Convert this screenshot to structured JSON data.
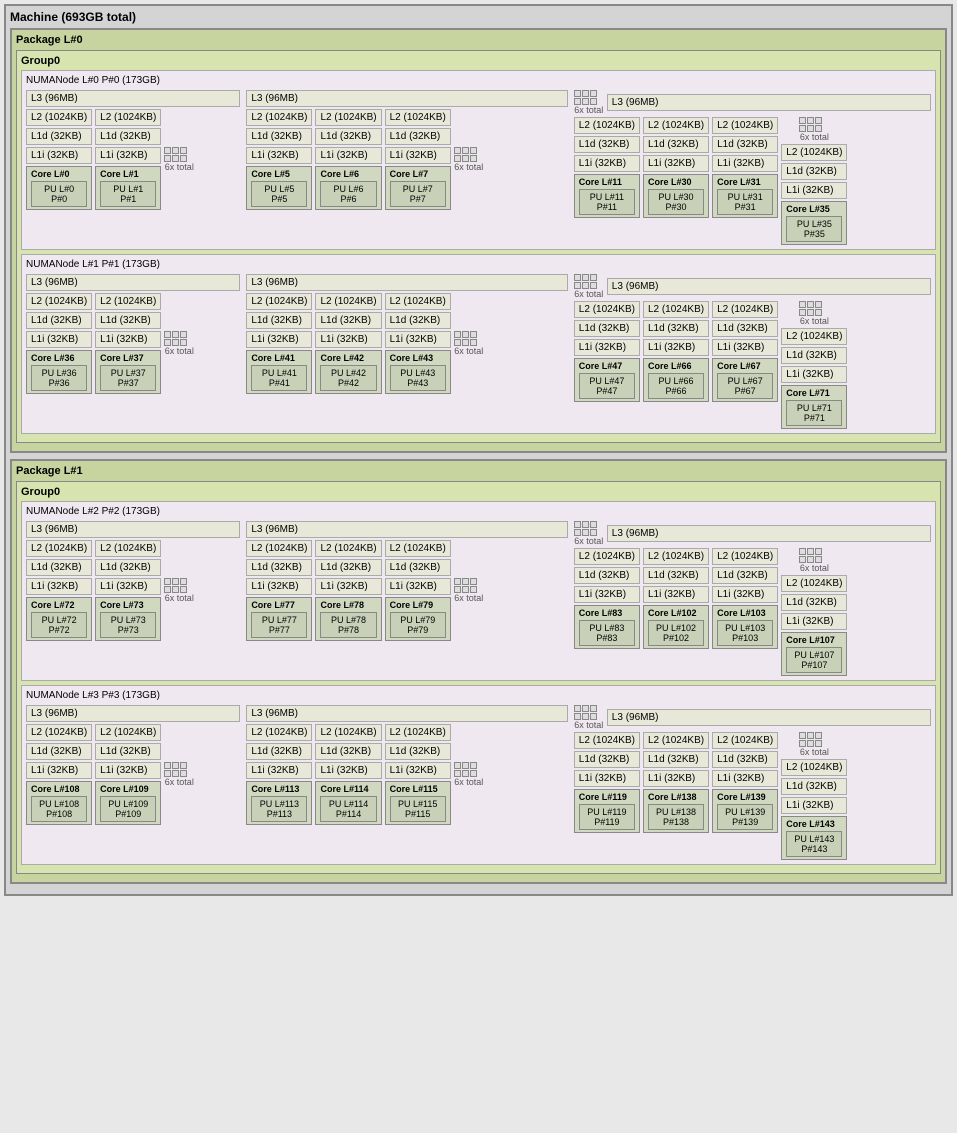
{
  "machine": {
    "title": "Machine (693GB total)",
    "packages": [
      {
        "label": "Package L#0",
        "groups": [
          {
            "label": "Group0",
            "numa": {
              "label": "NUMANode L#0 P#0 (173GB)",
              "segments": [
                {
                  "l3": "L3 (96MB)",
                  "cores": [
                    {
                      "label": "Core L#0",
                      "pu_label": "PU L#0",
                      "pu_p": "P#0"
                    },
                    {
                      "label": "Core L#1",
                      "pu_label": "PU L#1",
                      "pu_p": "P#1"
                    }
                  ],
                  "l2_left": [
                    "L2 (1024KB)",
                    "L2 (1024KB)"
                  ],
                  "l1d_left": [
                    "L1d (32KB)",
                    "L1d (32KB)"
                  ],
                  "l1i_left": [
                    "L1i (32KB)",
                    "L1i (32KB)"
                  ],
                  "extra_cores": [
                    {
                      "label": "Core L#5",
                      "pu_label": "PU L#5",
                      "pu_p": "P#5"
                    },
                    {
                      "label": "Core L#6",
                      "pu_label": "PU L#6",
                      "pu_p": "P#6"
                    },
                    {
                      "label": "Core L#7",
                      "pu_label": "PU L#7",
                      "pu_p": "P#7"
                    }
                  ]
                }
              ]
            }
          }
        ]
      }
    ]
  }
}
